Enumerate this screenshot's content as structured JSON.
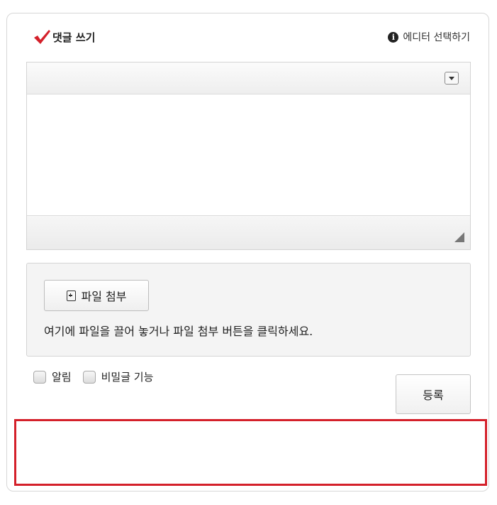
{
  "header": {
    "title": "댓글 쓰기",
    "editor_select_label": "에디터 선택하기",
    "check_icon": "check-mark-icon",
    "info_icon": "info-icon"
  },
  "editor": {
    "content": "",
    "toolbar_dropdown_icon": "chevron-down-icon",
    "resize_icon": "resize-handle-icon"
  },
  "attachment": {
    "button_label": "파일 첨부",
    "hint": "여기에 파일을 끌어 놓거나 파일 첨부 버튼을 클릭하세요.",
    "icon": "file-add-icon"
  },
  "options": {
    "notify_label": "알림",
    "secret_label": "비밀글 기능"
  },
  "actions": {
    "submit_label": "등록"
  },
  "colors": {
    "accent": "#d4202a",
    "border": "#d4d4d4"
  }
}
